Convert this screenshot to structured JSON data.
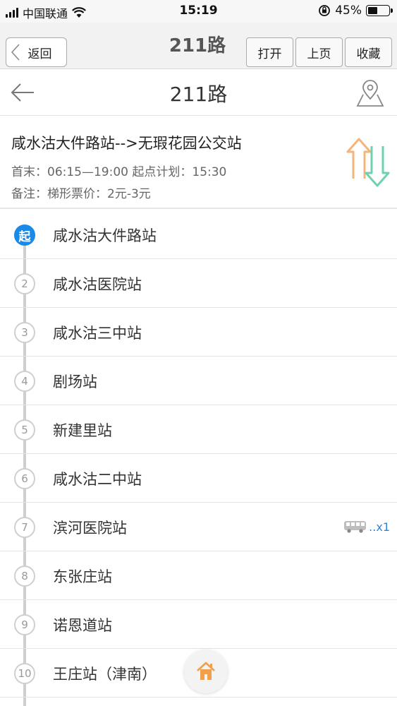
{
  "status_bar": {
    "carrier": "中国联通",
    "time": "15:19",
    "battery": "45%",
    "battery_level": 0.45
  },
  "app_bar": {
    "back_label": "返回",
    "title": "211路",
    "open_label": "打开",
    "prev_label": "上页",
    "favorite_label": "收藏"
  },
  "header": {
    "title": "211路"
  },
  "route": {
    "name": "咸水沽大件路站-->无瑕花园公交站",
    "hours": "首末：06:15—19:00 起点计划：15:30",
    "note": "备注：梯形票价：2元-3元"
  },
  "stops": [
    {
      "num": "起",
      "name": "咸水沽大件路站"
    },
    {
      "num": "2",
      "name": "咸水沽医院站"
    },
    {
      "num": "3",
      "name": "咸水沽三中站"
    },
    {
      "num": "4",
      "name": "剧场站"
    },
    {
      "num": "5",
      "name": "新建里站"
    },
    {
      "num": "6",
      "name": "咸水沽二中站"
    },
    {
      "num": "7",
      "name": "滨河医院站",
      "bus": "..x1"
    },
    {
      "num": "8",
      "name": "东张庄站"
    },
    {
      "num": "9",
      "name": "诺恩道站"
    },
    {
      "num": "10",
      "name": "王庄站（津南）"
    }
  ],
  "colors": {
    "accent_blue": "#1a8ae8",
    "swap_up": "#f5b57a",
    "swap_down": "#6fd1b0",
    "home_orange": "#f0a04b"
  },
  "icons": {
    "back": "chevron-left-icon",
    "arrow_back": "arrow-left-icon",
    "map": "map-pin-icon",
    "swap": "swap-direction-icon",
    "bus": "bus-icon",
    "home": "home-icon"
  }
}
